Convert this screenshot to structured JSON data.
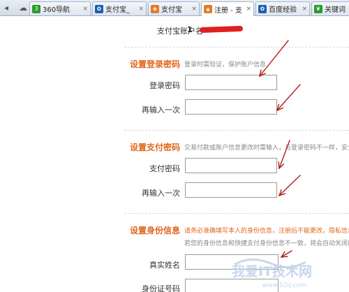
{
  "browser": {
    "nav_icon": "cloud-icon",
    "tabs": [
      {
        "label": "360导航",
        "favicon": "360-logo",
        "fav_text": "3",
        "fav_color": "#2a9d2a"
      },
      {
        "label": "支付宝_",
        "favicon": "paw-icon",
        "fav_text": "✿",
        "fav_color": "#1e5fb4"
      },
      {
        "label": "支付宝",
        "favicon": "shield-icon",
        "fav_text": "◈",
        "fav_color": "#e07a2a"
      },
      {
        "label": "注册 - 支",
        "favicon": "shield-icon",
        "fav_text": "◈",
        "fav_color": "#e07a2a"
      },
      {
        "label": "百度经验",
        "favicon": "paw-icon",
        "fav_text": "✿",
        "fav_color": "#1e5fb4"
      },
      {
        "label": "关键词",
        "favicon": "leaf-icon",
        "fav_text": "❦",
        "fav_color": "#2a9d2a"
      }
    ],
    "active_tab": 3,
    "close_glyph": "×"
  },
  "account": {
    "label": "支付宝账户名",
    "value_prefix": "1"
  },
  "login_password": {
    "title": "设置登录密码",
    "hint": "登录时需验证，保护账户信息",
    "fields": [
      "登录密码",
      "再输入一次"
    ]
  },
  "pay_password": {
    "title": "设置支付密码",
    "hint": "交易付款或账户信息更改时需输入，与登录密码不一样，安全级",
    "fields": [
      "支付密码",
      "再输入一次"
    ]
  },
  "identity": {
    "title": "设置身份信息",
    "hint_line1": "请务必准确填写本人的身份信息，注册后不能更改，隐私信息",
    "hint_line2": "若您的身份信息和快捷支付身份信息不一致，将会自动关闭已",
    "fields": [
      "真实姓名",
      "身份证号码"
    ]
  },
  "watermark": {
    "text": "我爱IT技术网",
    "subtext": "www.52ij.com"
  },
  "colors": {
    "section_title": "#e0661b",
    "annotation_arrow": "#b01c1c",
    "redaction": "#e02020"
  }
}
